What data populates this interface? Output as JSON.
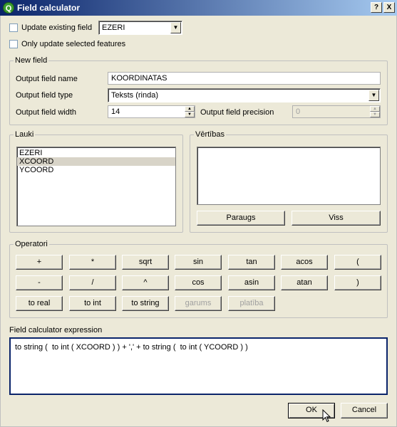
{
  "window": {
    "title": "Field calculator",
    "help_label": "?",
    "close_label": "X"
  },
  "top": {
    "update_existing_label": "Update existing field",
    "update_existing_checked": false,
    "existing_field_value": "EZERI",
    "only_selected_label": "Only update selected features",
    "only_selected_checked": false
  },
  "new_field": {
    "group_title": "New field",
    "name_label": "Output field name",
    "name_value": "KOORDINATAS",
    "type_label": "Output field type",
    "type_value": "Teksts (rinda)",
    "width_label": "Output field width",
    "width_value": "14",
    "precision_label": "Output field precision",
    "precision_value": "0"
  },
  "fields": {
    "group_title": "Lauki",
    "items": [
      {
        "label": "EZERI",
        "selected": false
      },
      {
        "label": "XCOORD",
        "selected": true
      },
      {
        "label": "YCOORD",
        "selected": false
      }
    ]
  },
  "values": {
    "group_title": "Vērtības",
    "sample_label": "Paraugs",
    "all_label": "Viss"
  },
  "operators": {
    "group_title": "Operatori",
    "row1": [
      "+",
      "*",
      "sqrt",
      "sin",
      "tan",
      "acos",
      "("
    ],
    "row2": [
      "-",
      "/",
      "^",
      "cos",
      "asin",
      "atan",
      ")"
    ],
    "row3": [
      "to real",
      "to int",
      "to string",
      "garums",
      "platība"
    ],
    "row3_disabled": [
      false,
      false,
      false,
      true,
      true
    ]
  },
  "expression": {
    "label": "Field calculator expression",
    "value": "to string (  to int ( XCOORD ) ) + ',' + to string (  to int ( YCOORD ) )"
  },
  "footer": {
    "ok_label": "OK",
    "cancel_label": "Cancel"
  }
}
